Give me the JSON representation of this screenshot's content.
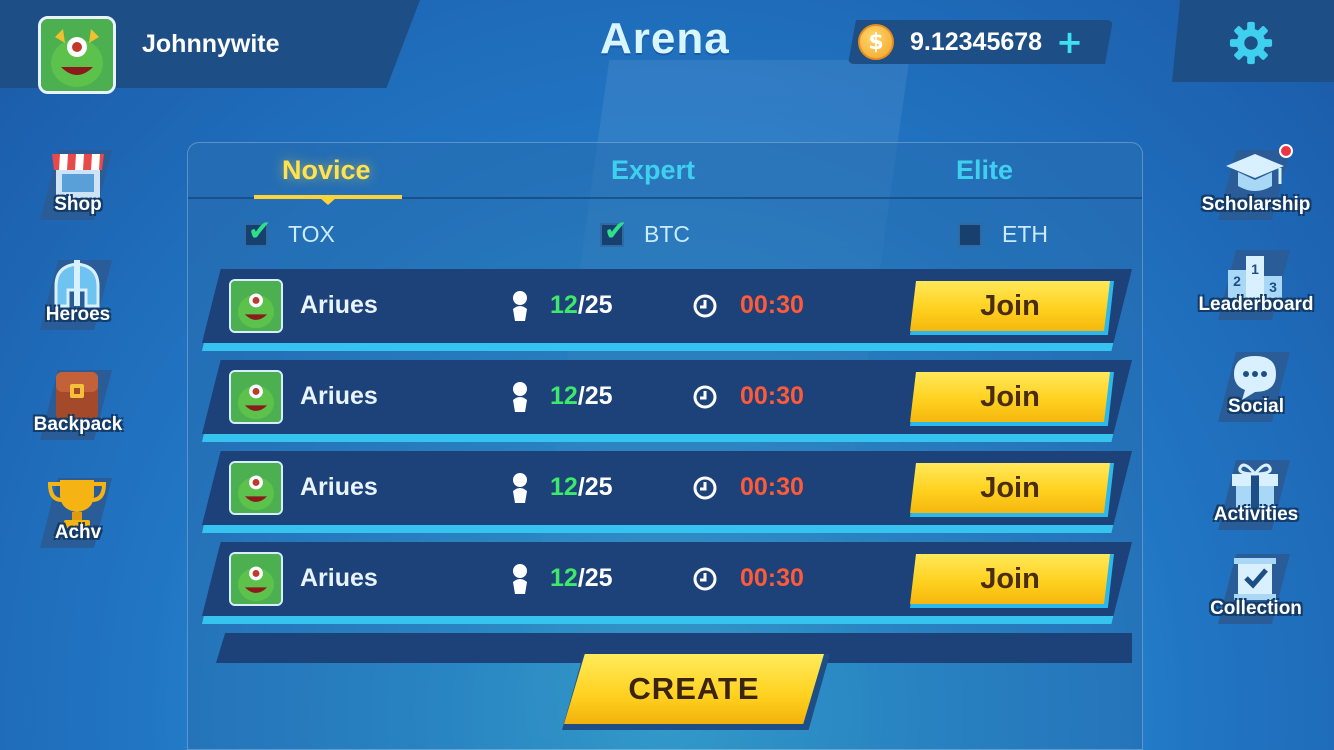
{
  "header": {
    "username": "Johnnywite",
    "title": "Arena",
    "balance": "9.12345678"
  },
  "left_nav": [
    {
      "label": "Shop",
      "icon": "shop-icon"
    },
    {
      "label": "Heroes",
      "icon": "heroes-icon"
    },
    {
      "label": "Backpack",
      "icon": "backpack-icon"
    },
    {
      "label": "Achv",
      "icon": "trophy-icon"
    }
  ],
  "right_nav": [
    {
      "label": "Scholarship",
      "icon": "graduation-cap-icon",
      "notification": true
    },
    {
      "label": "Leaderboard",
      "icon": "podium-icon"
    },
    {
      "label": "Social",
      "icon": "chat-bubble-icon"
    },
    {
      "label": "Activities",
      "icon": "gift-icon"
    },
    {
      "label": "Collection",
      "icon": "collection-icon"
    }
  ],
  "tabs": [
    {
      "label": "Novice",
      "active": true
    },
    {
      "label": "Expert",
      "active": false
    },
    {
      "label": "Elite",
      "active": false
    }
  ],
  "filters": [
    {
      "label": "TOX",
      "checked": true
    },
    {
      "label": "BTC",
      "checked": true
    },
    {
      "label": "ETH",
      "checked": false
    }
  ],
  "rooms": [
    {
      "name": "Ariues",
      "players_current": "12",
      "players_max": "/25",
      "timer": "00:30",
      "join_label": "Join"
    },
    {
      "name": "Ariues",
      "players_current": "12",
      "players_max": "/25",
      "timer": "00:30",
      "join_label": "Join"
    },
    {
      "name": "Ariues",
      "players_current": "12",
      "players_max": "/25",
      "timer": "00:30",
      "join_label": "Join"
    },
    {
      "name": "Ariues",
      "players_current": "12",
      "players_max": "/25",
      "timer": "00:30",
      "join_label": "Join"
    }
  ],
  "create_label": "CREATE",
  "colors": {
    "accent_yellow": "#ffd11f",
    "player_count_green": "#3ee86b",
    "timer_red": "#ff5a3a",
    "tab_inactive": "#3fd0f0"
  }
}
